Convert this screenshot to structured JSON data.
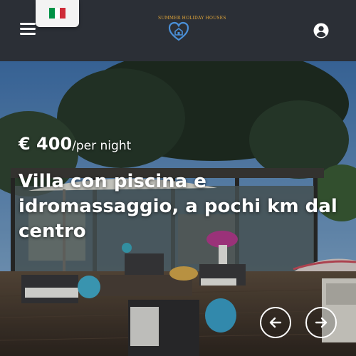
{
  "header": {
    "menu_icon": "hamburger-menu-icon",
    "language_flag": "italy-flag",
    "flag_colors": [
      "#009246",
      "#ffffff",
      "#ce2b37"
    ],
    "logo_text": "SUMMER HOLIDAY HOUSES",
    "logo_color": "#e0a53a",
    "heart_color": "#4a90d9",
    "user_icon": "user-account-icon"
  },
  "listing": {
    "price": "€ 400",
    "price_unit": "/per night",
    "title": "Villa con piscina e idromassaggio, a pochi km dal centro"
  },
  "carousel": {
    "prev_icon": "arrow-left-icon",
    "next_icon": "arrow-right-icon"
  }
}
